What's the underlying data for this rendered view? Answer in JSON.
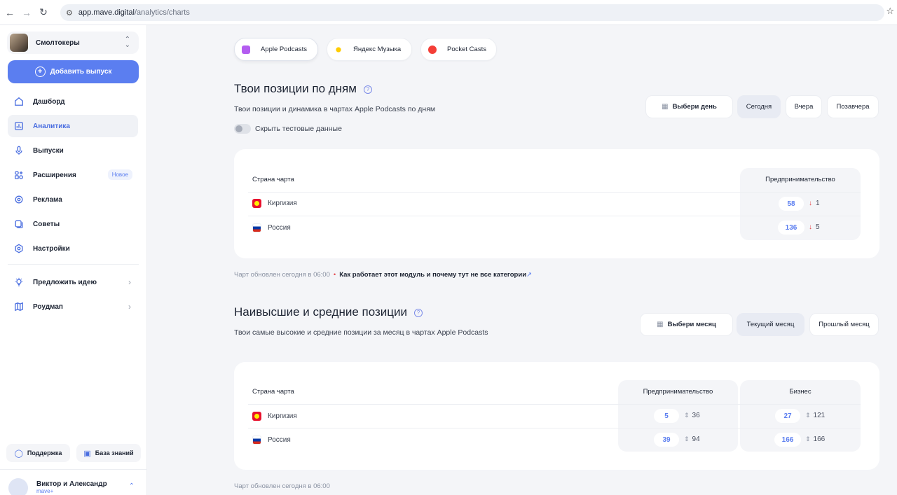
{
  "browser": {
    "url_domain": "app.mave.digital",
    "url_path": "/analytics/charts"
  },
  "sidebar": {
    "podcast_name": "Смолтокеры",
    "add_button": "Добавить выпуск",
    "items": [
      {
        "label": "Дашборд",
        "icon": "home-icon"
      },
      {
        "label": "Аналитика",
        "icon": "analytics-icon"
      },
      {
        "label": "Выпуски",
        "icon": "microphone-icon"
      },
      {
        "label": "Расширения",
        "icon": "extensions-icon",
        "badge": "Новое"
      },
      {
        "label": "Реклама",
        "icon": "target-icon"
      },
      {
        "label": "Советы",
        "icon": "tips-icon"
      },
      {
        "label": "Настройки",
        "icon": "gear-icon"
      }
    ],
    "extra_items": [
      {
        "label": "Предложить идею",
        "icon": "lightbulb-icon"
      },
      {
        "label": "Роудмап",
        "icon": "map-icon"
      }
    ],
    "support": "Поддержка",
    "knowledge_base": "База знаний",
    "user_name": "Виктор и Александр",
    "user_plan": "mave+"
  },
  "platforms": {
    "items": [
      {
        "label": "Apple Podcasts",
        "color": "#b35cf0"
      },
      {
        "label": "Яндекс Музыка",
        "color": "#ffcc00"
      },
      {
        "label": "Pocket Casts",
        "color": "#f43e37"
      }
    ]
  },
  "daily": {
    "title": "Твои позиции по дням",
    "subtitle": "Твои позиции и динамика в чартах Apple Podcasts по дням",
    "toggle_label": "Скрыть тестовые данные",
    "buttons": {
      "pick": "Выбери день",
      "today": "Сегодня",
      "yesterday": "Вчера",
      "day_before": "Позавчера"
    },
    "table": {
      "col_country": "Страна чарта",
      "col_category": "Предпринимательство",
      "rows": [
        {
          "country": "Киргизия",
          "position": "58",
          "delta": "1"
        },
        {
          "country": "Россия",
          "position": "136",
          "delta": "5"
        }
      ]
    },
    "footnote": "Чарт обновлен сегодня в 06:00",
    "footnote_link": "Как работает этот модуль и почему тут не все категории"
  },
  "monthly": {
    "title": "Наивысшие и средние позиции",
    "subtitle": "Твои самые высокие и средние позиции за месяц в чартах Apple Podcasts",
    "buttons": {
      "pick": "Выбери месяц",
      "current": "Текущий месяц",
      "previous": "Прошлый месяц"
    },
    "table": {
      "col_country": "Страна чарта",
      "col_cat1": "Предпринимательство",
      "col_cat2": "Бизнес",
      "rows": [
        {
          "country": "Киргизия",
          "best1": "5",
          "avg1": "36",
          "best2": "27",
          "avg2": "121"
        },
        {
          "country": "Россия",
          "best1": "39",
          "avg1": "94",
          "best2": "166",
          "avg2": "166"
        }
      ]
    },
    "footnote": "Чарт обновлен сегодня в 06:00"
  }
}
